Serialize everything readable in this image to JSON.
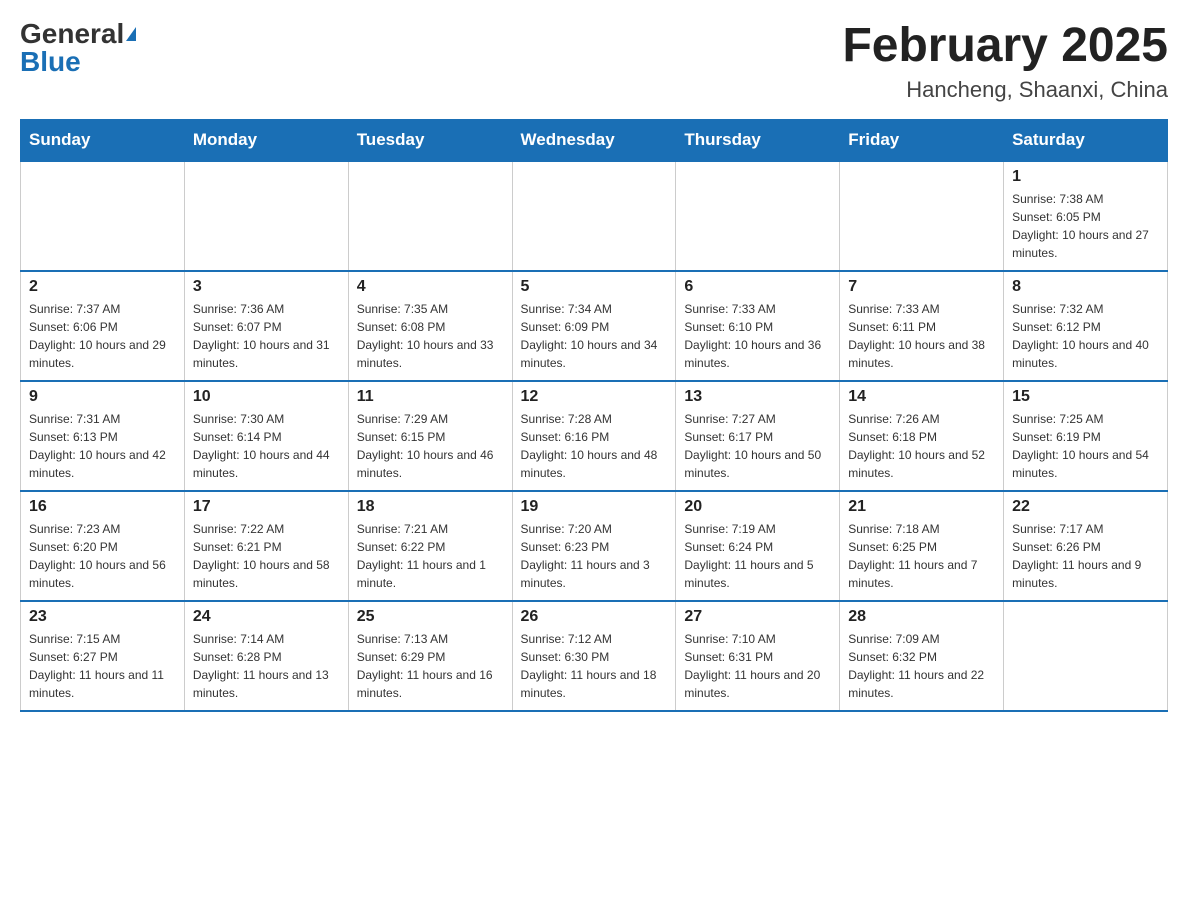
{
  "header": {
    "logo": {
      "general": "General",
      "blue": "Blue",
      "triangle": "▲"
    },
    "title": "February 2025",
    "location": "Hancheng, Shaanxi, China"
  },
  "days_of_week": [
    "Sunday",
    "Monday",
    "Tuesday",
    "Wednesday",
    "Thursday",
    "Friday",
    "Saturday"
  ],
  "weeks": [
    [
      {
        "day": "",
        "info": ""
      },
      {
        "day": "",
        "info": ""
      },
      {
        "day": "",
        "info": ""
      },
      {
        "day": "",
        "info": ""
      },
      {
        "day": "",
        "info": ""
      },
      {
        "day": "",
        "info": ""
      },
      {
        "day": "1",
        "info": "Sunrise: 7:38 AM\nSunset: 6:05 PM\nDaylight: 10 hours and 27 minutes."
      }
    ],
    [
      {
        "day": "2",
        "info": "Sunrise: 7:37 AM\nSunset: 6:06 PM\nDaylight: 10 hours and 29 minutes."
      },
      {
        "day": "3",
        "info": "Sunrise: 7:36 AM\nSunset: 6:07 PM\nDaylight: 10 hours and 31 minutes."
      },
      {
        "day": "4",
        "info": "Sunrise: 7:35 AM\nSunset: 6:08 PM\nDaylight: 10 hours and 33 minutes."
      },
      {
        "day": "5",
        "info": "Sunrise: 7:34 AM\nSunset: 6:09 PM\nDaylight: 10 hours and 34 minutes."
      },
      {
        "day": "6",
        "info": "Sunrise: 7:33 AM\nSunset: 6:10 PM\nDaylight: 10 hours and 36 minutes."
      },
      {
        "day": "7",
        "info": "Sunrise: 7:33 AM\nSunset: 6:11 PM\nDaylight: 10 hours and 38 minutes."
      },
      {
        "day": "8",
        "info": "Sunrise: 7:32 AM\nSunset: 6:12 PM\nDaylight: 10 hours and 40 minutes."
      }
    ],
    [
      {
        "day": "9",
        "info": "Sunrise: 7:31 AM\nSunset: 6:13 PM\nDaylight: 10 hours and 42 minutes."
      },
      {
        "day": "10",
        "info": "Sunrise: 7:30 AM\nSunset: 6:14 PM\nDaylight: 10 hours and 44 minutes."
      },
      {
        "day": "11",
        "info": "Sunrise: 7:29 AM\nSunset: 6:15 PM\nDaylight: 10 hours and 46 minutes."
      },
      {
        "day": "12",
        "info": "Sunrise: 7:28 AM\nSunset: 6:16 PM\nDaylight: 10 hours and 48 minutes."
      },
      {
        "day": "13",
        "info": "Sunrise: 7:27 AM\nSunset: 6:17 PM\nDaylight: 10 hours and 50 minutes."
      },
      {
        "day": "14",
        "info": "Sunrise: 7:26 AM\nSunset: 6:18 PM\nDaylight: 10 hours and 52 minutes."
      },
      {
        "day": "15",
        "info": "Sunrise: 7:25 AM\nSunset: 6:19 PM\nDaylight: 10 hours and 54 minutes."
      }
    ],
    [
      {
        "day": "16",
        "info": "Sunrise: 7:23 AM\nSunset: 6:20 PM\nDaylight: 10 hours and 56 minutes."
      },
      {
        "day": "17",
        "info": "Sunrise: 7:22 AM\nSunset: 6:21 PM\nDaylight: 10 hours and 58 minutes."
      },
      {
        "day": "18",
        "info": "Sunrise: 7:21 AM\nSunset: 6:22 PM\nDaylight: 11 hours and 1 minute."
      },
      {
        "day": "19",
        "info": "Sunrise: 7:20 AM\nSunset: 6:23 PM\nDaylight: 11 hours and 3 minutes."
      },
      {
        "day": "20",
        "info": "Sunrise: 7:19 AM\nSunset: 6:24 PM\nDaylight: 11 hours and 5 minutes."
      },
      {
        "day": "21",
        "info": "Sunrise: 7:18 AM\nSunset: 6:25 PM\nDaylight: 11 hours and 7 minutes."
      },
      {
        "day": "22",
        "info": "Sunrise: 7:17 AM\nSunset: 6:26 PM\nDaylight: 11 hours and 9 minutes."
      }
    ],
    [
      {
        "day": "23",
        "info": "Sunrise: 7:15 AM\nSunset: 6:27 PM\nDaylight: 11 hours and 11 minutes."
      },
      {
        "day": "24",
        "info": "Sunrise: 7:14 AM\nSunset: 6:28 PM\nDaylight: 11 hours and 13 minutes."
      },
      {
        "day": "25",
        "info": "Sunrise: 7:13 AM\nSunset: 6:29 PM\nDaylight: 11 hours and 16 minutes."
      },
      {
        "day": "26",
        "info": "Sunrise: 7:12 AM\nSunset: 6:30 PM\nDaylight: 11 hours and 18 minutes."
      },
      {
        "day": "27",
        "info": "Sunrise: 7:10 AM\nSunset: 6:31 PM\nDaylight: 11 hours and 20 minutes."
      },
      {
        "day": "28",
        "info": "Sunrise: 7:09 AM\nSunset: 6:32 PM\nDaylight: 11 hours and 22 minutes."
      },
      {
        "day": "",
        "info": ""
      }
    ]
  ]
}
